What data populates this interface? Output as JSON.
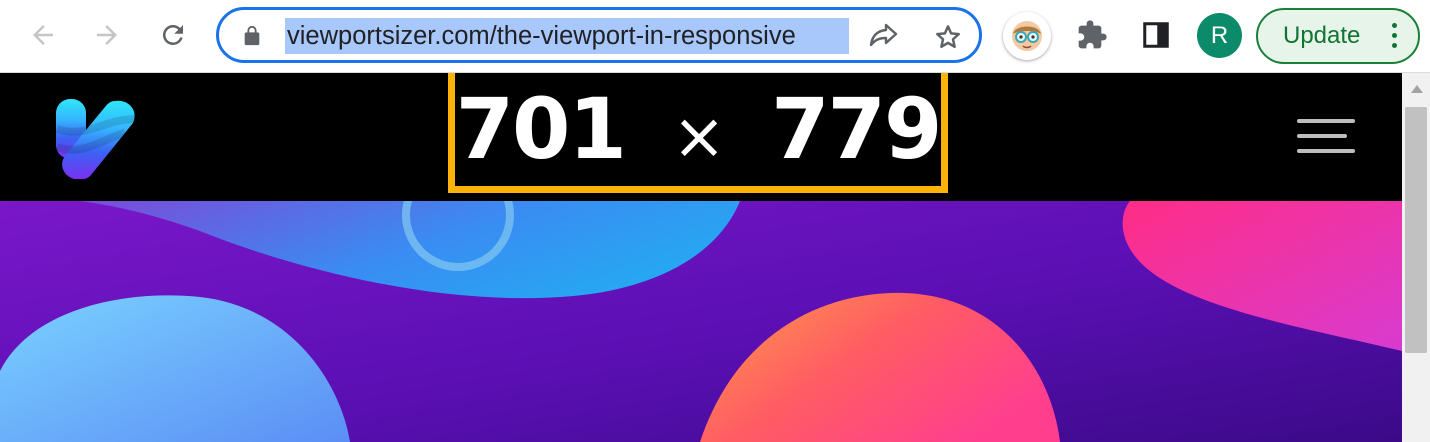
{
  "browser": {
    "url": "viewportsizer.com/the-viewport-in-responsive",
    "profile_initial": "R",
    "update_label": "Update",
    "icons": {
      "back": "arrow-left-icon",
      "forward": "arrow-right-icon",
      "reload": "reload-icon",
      "lock": "lock-icon",
      "share": "share-icon",
      "bookmark": "star-icon",
      "extension_avatar": "extension-avatar-icon",
      "extensions": "puzzle-icon",
      "side_panel": "side-panel-icon",
      "menu": "kebab-menu-icon"
    },
    "colors": {
      "omnibox_border": "#1a73e8",
      "url_selection": "#a8c7fa",
      "update_green": "#137333",
      "profile_bg": "#0b8b6a"
    }
  },
  "site": {
    "viewport_width": "701",
    "times_sign": "×",
    "viewport_height": "779",
    "logo": "viewportsizer-logo",
    "menu_icon": "hamburger-menu-icon",
    "colors": {
      "header_bg": "#000000",
      "size_box_border": "#fbb30a"
    }
  }
}
